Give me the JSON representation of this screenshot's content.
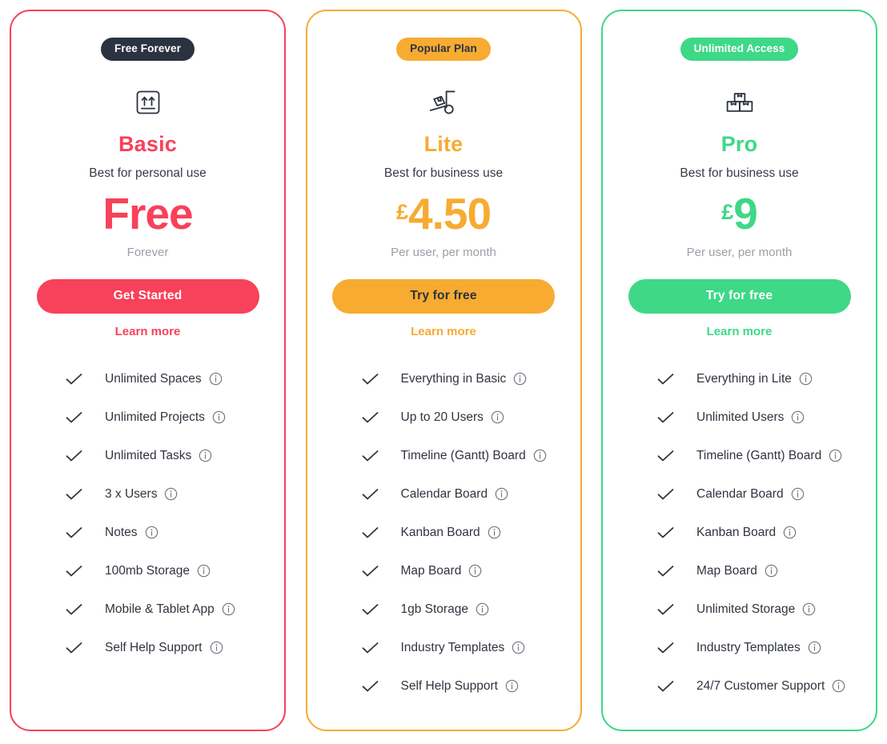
{
  "colors": {
    "basic": "#F8415A",
    "lite": "#F7AB31",
    "pro": "#3ED887",
    "badge_basic_bg": "#2B3240",
    "text_dark": "#2F353F",
    "text_muted": "#9AA0A8"
  },
  "plans": [
    {
      "id": "basic",
      "badge": "Free Forever",
      "icon": "arrows-up-box-icon",
      "name": "Basic",
      "tagline": "Best for personal use",
      "currency": "",
      "price": "Free",
      "price_note": "Forever",
      "cta_label": "Get Started",
      "learn_more_label": "Learn more",
      "features": [
        "Unlimited Spaces",
        "Unlimited Projects",
        "Unlimited Tasks",
        "3 x Users",
        "Notes",
        "100mb Storage",
        "Mobile & Tablet App",
        "Self Help Support"
      ]
    },
    {
      "id": "lite",
      "badge": "Popular Plan",
      "icon": "hand-truck-box-icon",
      "name": "Lite",
      "tagline": "Best for business use",
      "currency": "£",
      "price": "4.50",
      "price_note": "Per user, per month",
      "cta_label": "Try for free",
      "learn_more_label": "Learn more",
      "features": [
        "Everything in Basic",
        "Up to 20 Users",
        "Timeline (Gantt) Board",
        "Calendar Board",
        "Kanban Board",
        "Map Board",
        "1gb Storage",
        "Industry Templates",
        "Self Help Support"
      ]
    },
    {
      "id": "pro",
      "badge": "Unlimited Access",
      "icon": "stacked-boxes-icon",
      "name": "Pro",
      "tagline": "Best for business use",
      "currency": "£",
      "price": "9",
      "price_note": "Per user, per month",
      "cta_label": "Try for free",
      "learn_more_label": "Learn more",
      "features": [
        "Everything in Lite",
        "Unlimited Users",
        "Timeline (Gantt) Board",
        "Calendar Board",
        "Kanban Board",
        "Map Board",
        "Unlimited Storage",
        "Industry Templates",
        "24/7 Customer Support"
      ]
    }
  ]
}
